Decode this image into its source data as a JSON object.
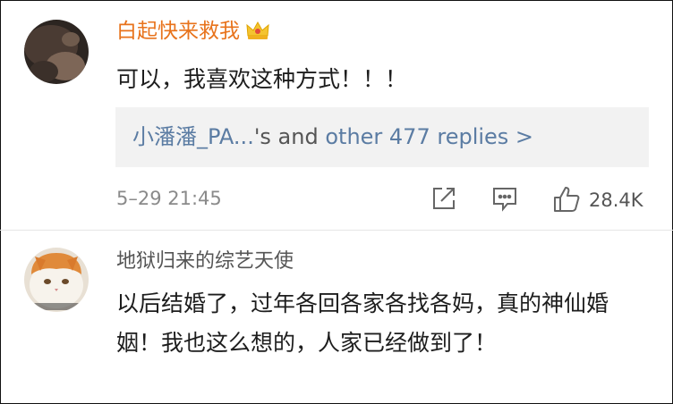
{
  "comments": [
    {
      "username": "白起快来救我",
      "text": "可以，我喜欢这种方式！！！",
      "replies": {
        "names": "小潘潘_PA...",
        "middle": "'s and ",
        "more": "other 477 replies >"
      },
      "time": "5–29 21:45",
      "likes": "28.4K"
    },
    {
      "username": "地狱归来的综艺天使",
      "text": "以后结婚了，过年各回各家各找各妈，真的神仙婚姻！我也这么想的，人家已经做到了！"
    }
  ],
  "colors": {
    "vip_name": "#e8731c",
    "link": "#5b7ca3",
    "meta": "#8a8a8a"
  },
  "icons": [
    "crown-icon",
    "share-icon",
    "comment-icon",
    "like-icon"
  ]
}
